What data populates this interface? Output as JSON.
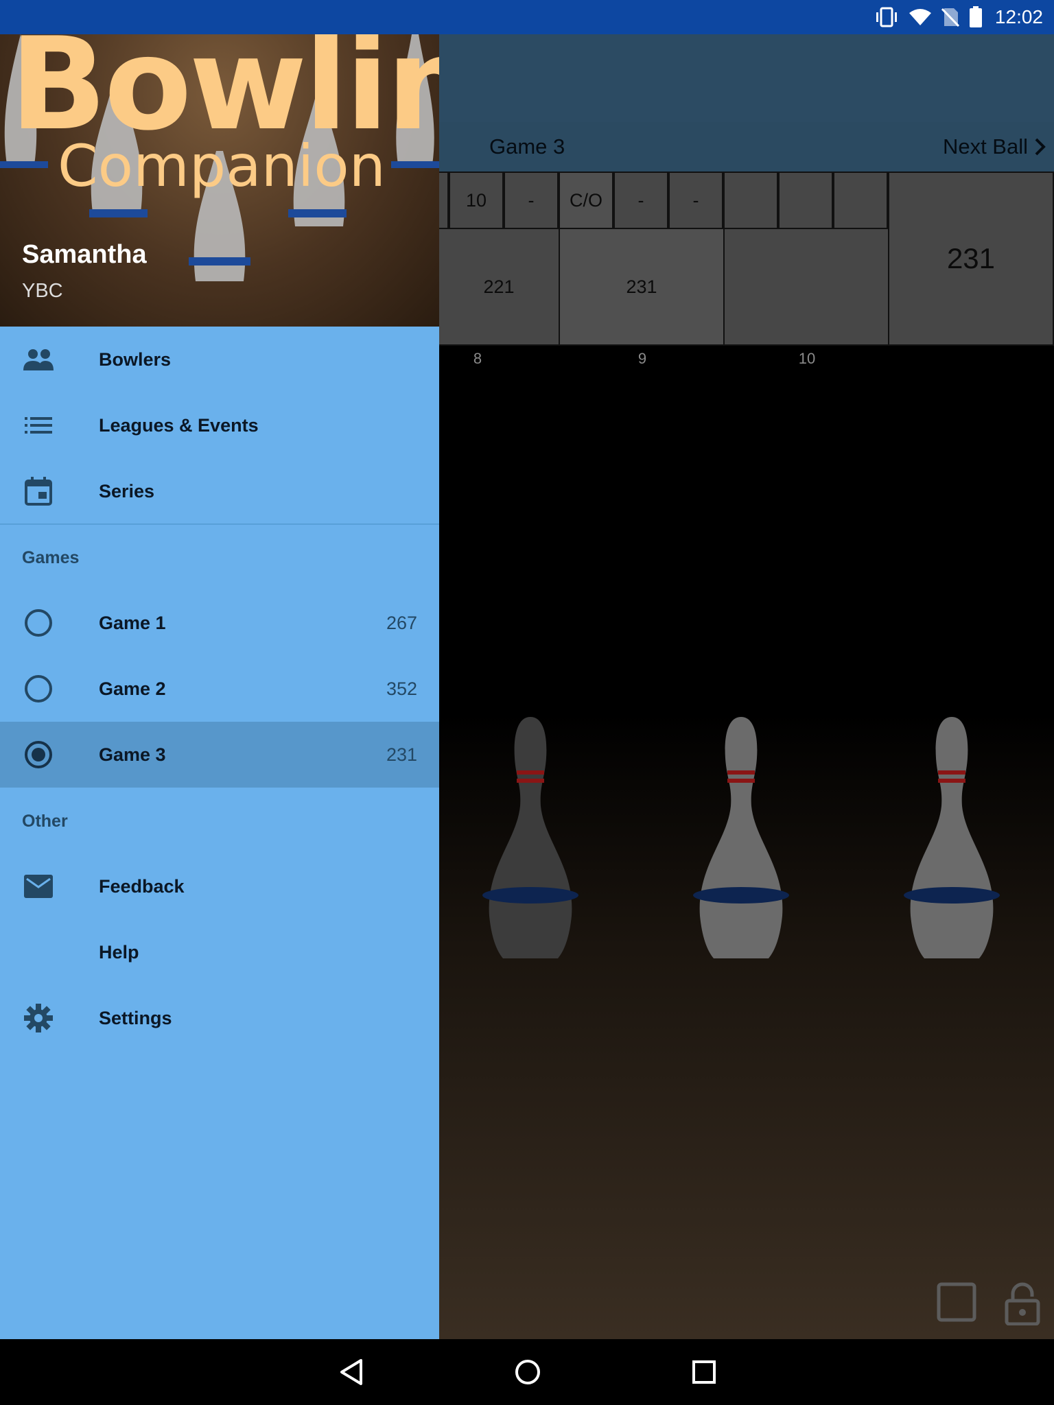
{
  "status_bar": {
    "time": "12:02"
  },
  "drawer": {
    "logo_line1": "Bowling",
    "logo_line2": "Companion",
    "profile_name": "Samantha",
    "profile_subtitle": "YBC",
    "nav_items": [
      {
        "label": "Bowlers",
        "icon": "people-icon"
      },
      {
        "label": "Leagues & Events",
        "icon": "list-icon"
      },
      {
        "label": "Series",
        "icon": "calendar-icon"
      }
    ],
    "games_header": "Games",
    "games": [
      {
        "label": "Game 1",
        "score": "267",
        "selected": false
      },
      {
        "label": "Game 2",
        "score": "352",
        "selected": false
      },
      {
        "label": "Game 3",
        "score": "231",
        "selected": true
      }
    ],
    "other_header": "Other",
    "other_items": [
      {
        "label": "Feedback",
        "icon": "mail-icon"
      },
      {
        "label": "Help",
        "icon": ""
      },
      {
        "label": "Settings",
        "icon": "gear-icon"
      }
    ]
  },
  "game": {
    "title": "Game 3",
    "next_ball_label": "Next Ball",
    "ball_boxes": [
      "10",
      "-",
      "C/O",
      "-",
      "-",
      "",
      "",
      ""
    ],
    "frame_scores": [
      "221",
      "231",
      ""
    ],
    "total_score": "231",
    "frame_numbers": [
      "8",
      "9",
      "10"
    ]
  },
  "colors": {
    "drawer_bg": "#6ab1ec",
    "selected_item_bg": "#5797cb",
    "status_bar": "#0d47a1",
    "logo": "#fccb86"
  }
}
